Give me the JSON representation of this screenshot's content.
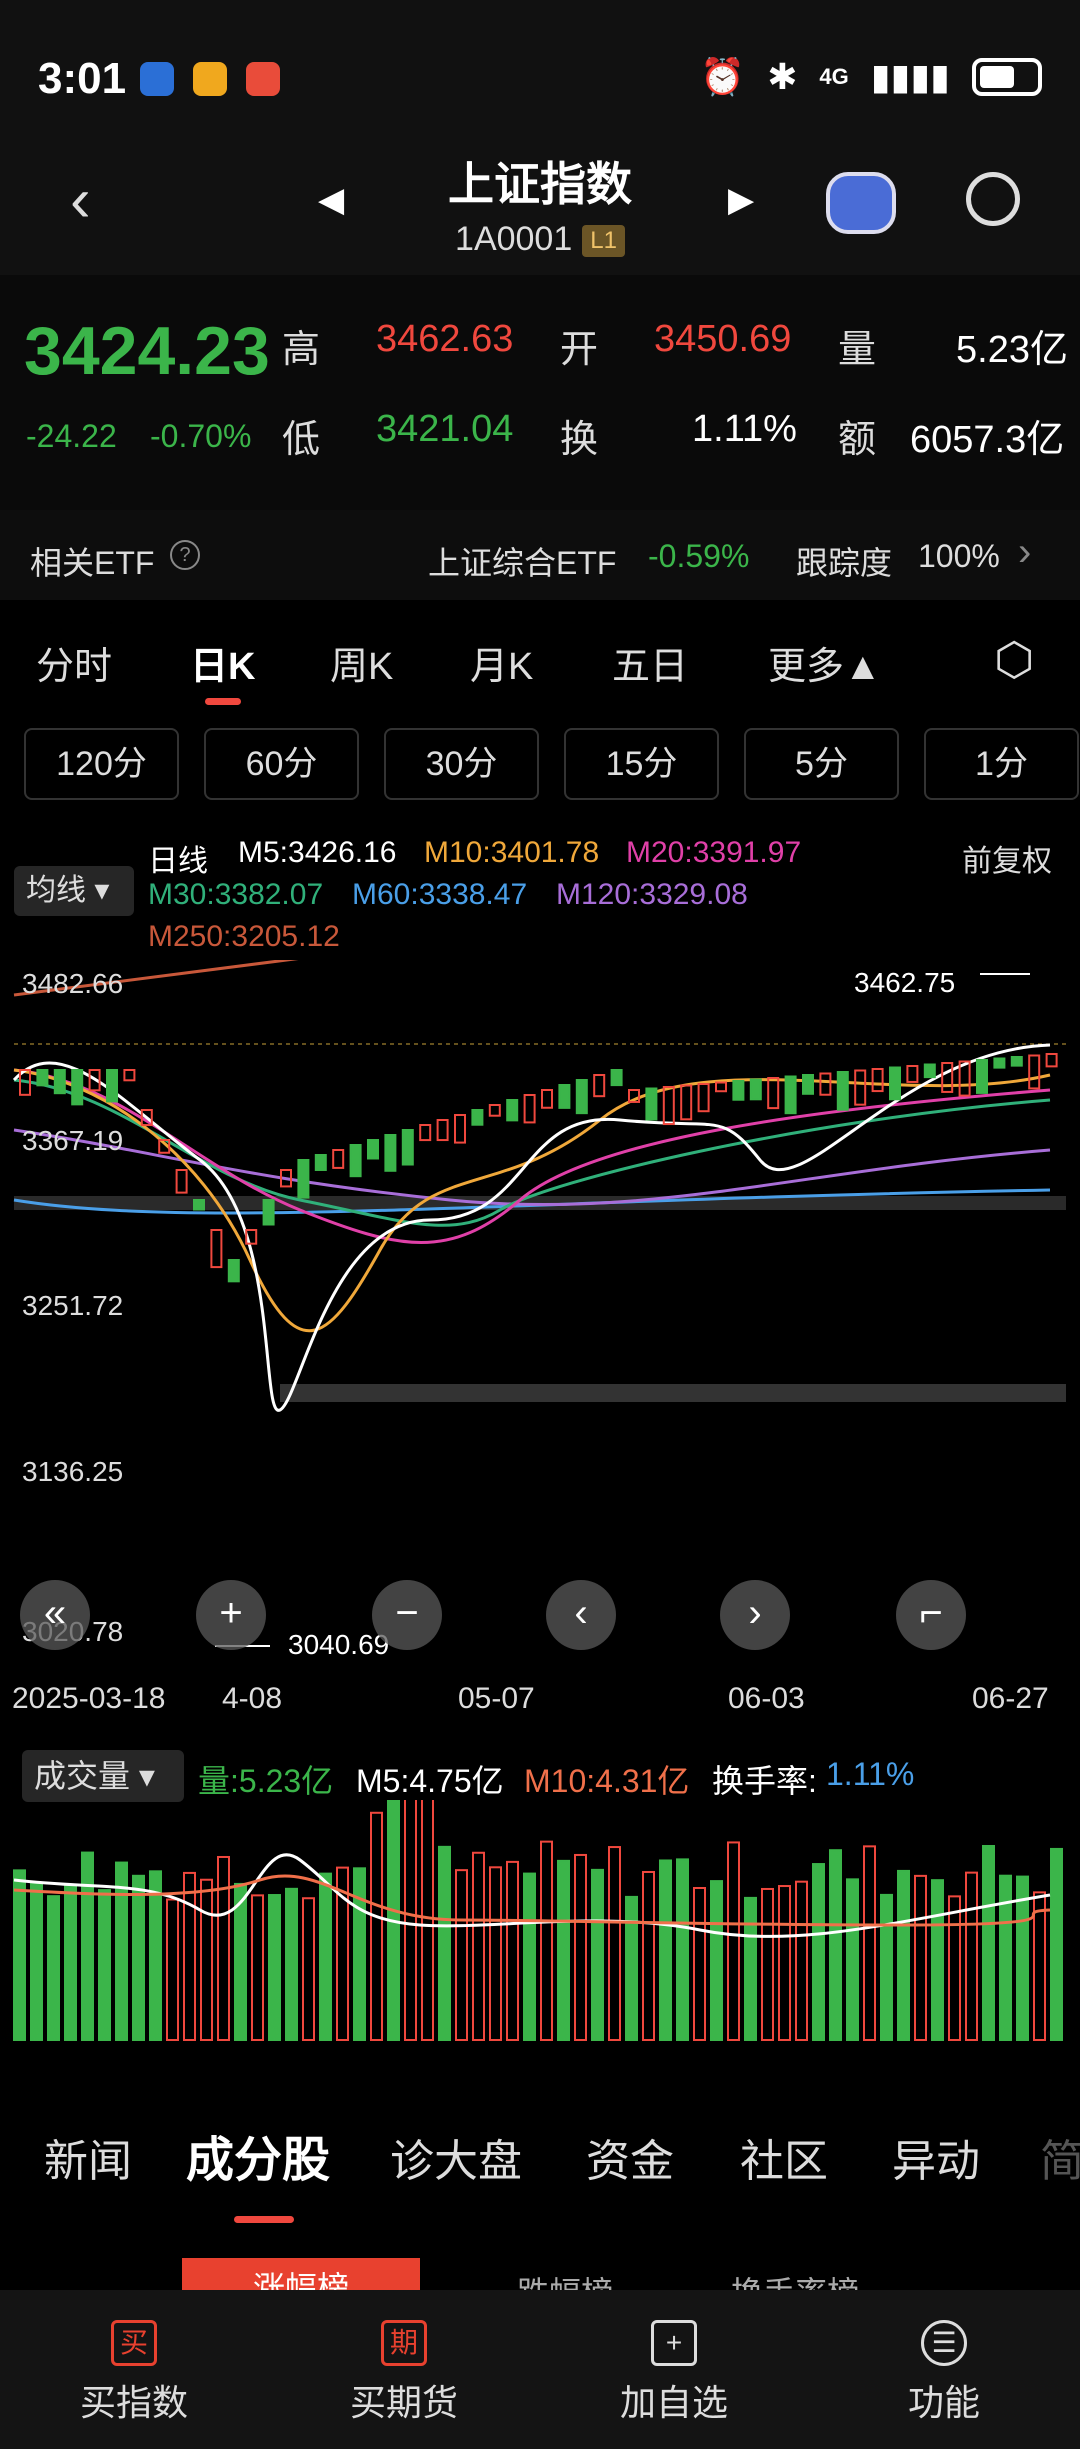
{
  "status": {
    "time": "3:01",
    "net": "4G"
  },
  "header": {
    "title": "上证指数",
    "code": "1A0001",
    "level": "L1"
  },
  "quote": {
    "price": "3424.23",
    "change": "-24.22",
    "pct": "-0.70%",
    "high_label": "高",
    "high": "3462.63",
    "open_label": "开",
    "open": "3450.69",
    "vol_label": "量",
    "vol": "5.23亿",
    "low_label": "低",
    "low": "3421.04",
    "turn_label": "换",
    "turn": "1.11%",
    "amt_label": "额",
    "amt": "6057.3亿"
  },
  "etf": {
    "label": "相关ETF",
    "name": "上证综合ETF",
    "pct": "-0.59%",
    "track_label": "跟踪度",
    "track": "100%"
  },
  "tabs": [
    "分时",
    "日K",
    "周K",
    "月K",
    "五日",
    "更多▲"
  ],
  "periods": [
    "120分",
    "60分",
    "30分",
    "15分",
    "5分",
    "1分"
  ],
  "ma": {
    "ma_button": "均线",
    "kind": "日线",
    "m5": "M5:3426.16",
    "m10": "M10:3401.78",
    "m20": "M20:3391.97",
    "m30": "M30:3382.07",
    "m60": "M60:3338.47",
    "m120": "M120:3329.08",
    "m250": "M250:3205.12",
    "adj": "前复权"
  },
  "price_axis": [
    "3482.66",
    "3367.19",
    "3251.72",
    "3136.25",
    "3020.78"
  ],
  "marks": {
    "high": "3462.75",
    "low": "3040.69"
  },
  "dates": [
    "2025-03-18",
    "4-08",
    "05-07",
    "06-03",
    "06-27"
  ],
  "volume": {
    "button": "成交量",
    "v": "量:5.23亿",
    "m5": "M5:4.75亿",
    "m10": "M10:4.31亿",
    "turn": "换手率:",
    "turn_val": "1.11%"
  },
  "bottom_tabs": [
    "新闻",
    "成分股",
    "诊大盘",
    "资金",
    "社区",
    "异动",
    "简"
  ],
  "sub_tabs": [
    "涨幅榜",
    "跌幅榜",
    "换手率榜"
  ],
  "bnav": [
    {
      "icon": "买",
      "label": "买指数"
    },
    {
      "icon": "期",
      "label": "买期货"
    },
    {
      "icon": "+",
      "label": "加自选"
    },
    {
      "icon": "☰",
      "label": "功能"
    }
  ],
  "chart_data": {
    "type": "candlestick",
    "ylim": [
      3020.78,
      3482.66
    ],
    "last": "3424.23"
  }
}
